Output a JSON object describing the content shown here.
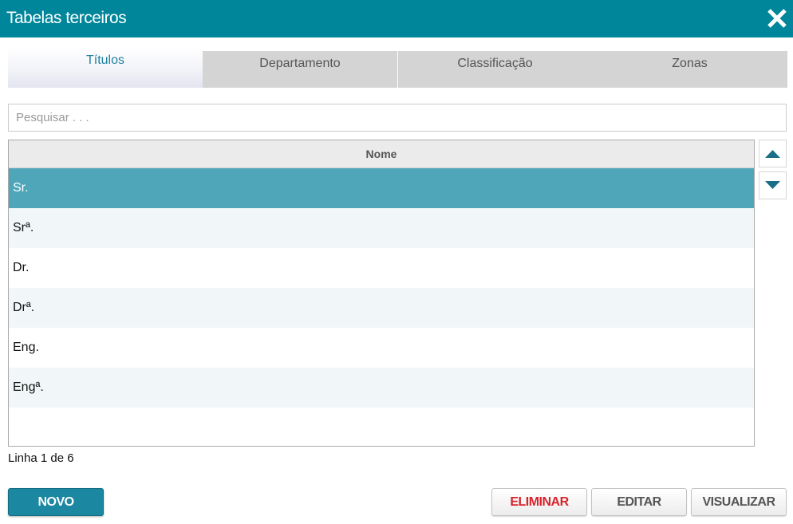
{
  "window": {
    "title": "Tabelas terceiros"
  },
  "tabs": [
    {
      "label": "Títulos",
      "active": true
    },
    {
      "label": "Departamento",
      "active": false
    },
    {
      "label": "Classificação",
      "active": false
    },
    {
      "label": "Zonas",
      "active": false
    }
  ],
  "search": {
    "placeholder": "Pesquisar . . ."
  },
  "grid": {
    "column_header": "Nome",
    "rows": [
      "Sr.",
      "Srª.",
      "Dr.",
      "Drª.",
      "Eng.",
      "Engª."
    ],
    "selected_index": 0
  },
  "status": {
    "text": "Linha 1 de 6"
  },
  "buttons": {
    "new_label": "NOVO",
    "delete_label": "ELIMINAR",
    "edit_label": "EDITAR",
    "view_label": "VISUALIZAR"
  },
  "colors": {
    "header": "#00869a",
    "selected_row": "#4ea6b8",
    "alt_row": "#f1f7f8",
    "primary_button": "#1b87a0",
    "danger_text": "#d9232b",
    "arrow": "#1a6f87"
  },
  "icons": {
    "close": "close-icon",
    "move_up": "triangle-up-icon",
    "move_down": "triangle-down-icon"
  }
}
